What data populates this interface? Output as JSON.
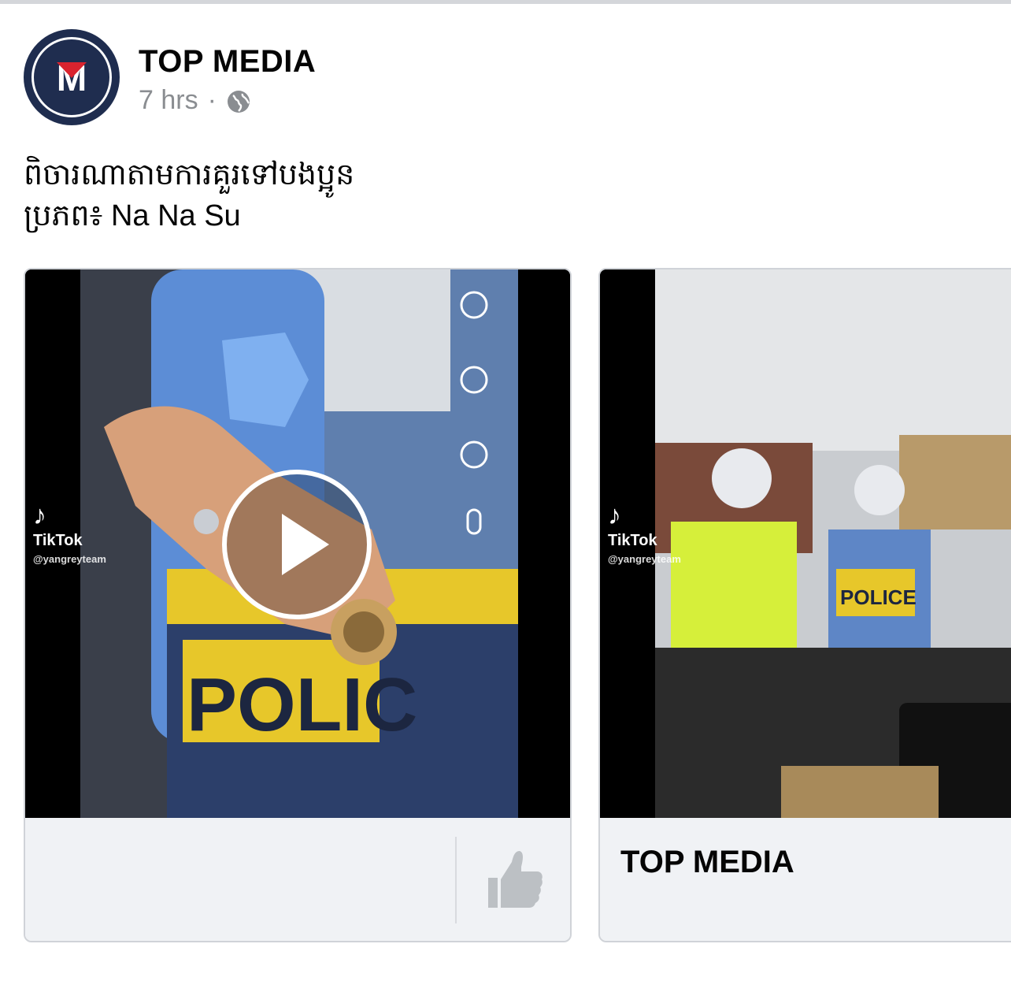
{
  "post": {
    "page_name": "TOP MEDIA",
    "time": "7 hrs",
    "separator": "·",
    "privacy_icon": "globe-icon",
    "caption_line1": "ពិចារណាតាមការគួរទៅបងប្អូន",
    "caption_line2": "ប្រភព៖ Na Na Su"
  },
  "avatar": {
    "logo_letter": "M",
    "colors": {
      "bg": "#1f2d4f",
      "accent": "#d9232e"
    }
  },
  "videos": [
    {
      "watermark": "TikTok",
      "watermark_user": "@yangreyteam",
      "overlay_text": "POLIC",
      "play_icon": "play-icon",
      "like_icon": "thumbs-up-icon"
    },
    {
      "watermark": "TikTok",
      "watermark_user": "@yangreyteam",
      "overlay_text": "POLICE",
      "title": "TOP MEDIA"
    }
  ],
  "colors": {
    "muted_text": "#8a8d91",
    "card_bg": "#f0f2f5",
    "like_icon": "#bcc0c4"
  }
}
